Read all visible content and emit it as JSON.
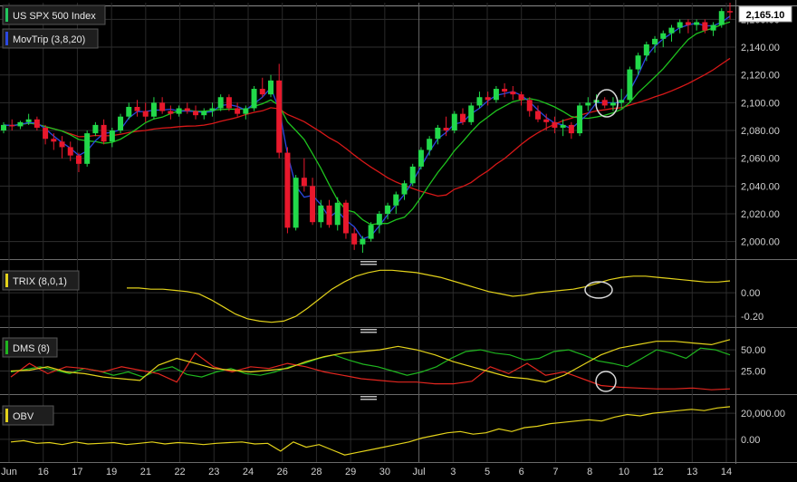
{
  "chart_data": [
    {
      "type": "candlestick",
      "title": "US SPX 500 Index",
      "overlay_label": "MovTrip (3,8,20)",
      "last_price_label": "2,165.10",
      "y_ticks": [
        "2,000.00",
        "2,020.00",
        "2,040.00",
        "2,060.00",
        "2,080.00",
        "2,100.00",
        "2,120.00",
        "2,140.00",
        "2,160.00"
      ],
      "ylim": [
        1990,
        2172
      ],
      "colors": {
        "up": "#22d94a",
        "down": "#e8182c",
        "fast": "#2a47e0",
        "mid": "#1ec21e",
        "slow": "#d81818"
      },
      "candles": [
        [
          2080,
          2086,
          2078,
          2084
        ],
        [
          2084,
          2088,
          2080,
          2083
        ],
        [
          2083,
          2087,
          2081,
          2086
        ],
        [
          2086,
          2092,
          2084,
          2088
        ],
        [
          2088,
          2090,
          2080,
          2082
        ],
        [
          2082,
          2084,
          2070,
          2074
        ],
        [
          2074,
          2078,
          2066,
          2072
        ],
        [
          2072,
          2076,
          2060,
          2068
        ],
        [
          2068,
          2072,
          2058,
          2062
        ],
        [
          2062,
          2064,
          2050,
          2056
        ],
        [
          2056,
          2080,
          2054,
          2078
        ],
        [
          2078,
          2086,
          2076,
          2084
        ],
        [
          2084,
          2088,
          2070,
          2072
        ],
        [
          2072,
          2082,
          2068,
          2080
        ],
        [
          2080,
          2092,
          2078,
          2090
        ],
        [
          2090,
          2100,
          2088,
          2097
        ],
        [
          2097,
          2102,
          2090,
          2094
        ],
        [
          2094,
          2100,
          2086,
          2090
        ],
        [
          2090,
          2104,
          2088,
          2100
        ],
        [
          2100,
          2104,
          2092,
          2094
        ],
        [
          2094,
          2098,
          2088,
          2092
        ],
        [
          2092,
          2098,
          2090,
          2096
        ],
        [
          2096,
          2100,
          2092,
          2094
        ],
        [
          2094,
          2098,
          2088,
          2091
        ],
        [
          2091,
          2096,
          2088,
          2094
        ],
        [
          2094,
          2100,
          2090,
          2096
        ],
        [
          2096,
          2106,
          2094,
          2104
        ],
        [
          2104,
          2106,
          2094,
          2096
        ],
        [
          2096,
          2100,
          2090,
          2092
        ],
        [
          2092,
          2098,
          2088,
          2096
        ],
        [
          2096,
          2112,
          2094,
          2110
        ],
        [
          2110,
          2118,
          2104,
          2106
        ],
        [
          2106,
          2120,
          2104,
          2116
        ],
        [
          2116,
          2128,
          2060,
          2064
        ],
        [
          2064,
          2068,
          2006,
          2010
        ],
        [
          2010,
          2048,
          2008,
          2046
        ],
        [
          2046,
          2060,
          2036,
          2040
        ],
        [
          2040,
          2046,
          2012,
          2014
        ],
        [
          2014,
          2030,
          2010,
          2026
        ],
        [
          2026,
          2030,
          2010,
          2012
        ],
        [
          2012,
          2032,
          2008,
          2028
        ],
        [
          2028,
          2030,
          2002,
          2006
        ],
        [
          2006,
          2010,
          1994,
          1998
        ],
        [
          1998,
          2004,
          1992,
          2002
        ],
        [
          2002,
          2014,
          2000,
          2012
        ],
        [
          2012,
          2022,
          2006,
          2020
        ],
        [
          2020,
          2028,
          2016,
          2026
        ],
        [
          2026,
          2036,
          2020,
          2034
        ],
        [
          2034,
          2044,
          2030,
          2042
        ],
        [
          2042,
          2056,
          2040,
          2054
        ],
        [
          2054,
          2068,
          2052,
          2066
        ],
        [
          2066,
          2076,
          2062,
          2074
        ],
        [
          2074,
          2084,
          2070,
          2082
        ],
        [
          2082,
          2090,
          2076,
          2080
        ],
        [
          2080,
          2094,
          2078,
          2092
        ],
        [
          2092,
          2096,
          2084,
          2086
        ],
        [
          2086,
          2100,
          2084,
          2098
        ],
        [
          2098,
          2108,
          2096,
          2104
        ],
        [
          2104,
          2108,
          2098,
          2102
        ],
        [
          2102,
          2112,
          2100,
          2110
        ],
        [
          2110,
          2114,
          2104,
          2108
        ],
        [
          2108,
          2112,
          2102,
          2106
        ],
        [
          2106,
          2108,
          2098,
          2102
        ],
        [
          2102,
          2104,
          2090,
          2094
        ],
        [
          2094,
          2098,
          2086,
          2088
        ],
        [
          2088,
          2092,
          2080,
          2086
        ],
        [
          2086,
          2090,
          2078,
          2082
        ],
        [
          2082,
          2088,
          2076,
          2084
        ],
        [
          2084,
          2086,
          2074,
          2078
        ],
        [
          2078,
          2100,
          2076,
          2098
        ],
        [
          2098,
          2104,
          2094,
          2100
        ],
        [
          2100,
          2106,
          2096,
          2102
        ],
        [
          2102,
          2104,
          2096,
          2098
        ],
        [
          2098,
          2104,
          2094,
          2100
        ],
        [
          2100,
          2110,
          2096,
          2102
        ],
        [
          2102,
          2126,
          2100,
          2124
        ],
        [
          2124,
          2136,
          2120,
          2134
        ],
        [
          2134,
          2144,
          2130,
          2142
        ],
        [
          2142,
          2148,
          2136,
          2146
        ],
        [
          2146,
          2152,
          2140,
          2150
        ],
        [
          2150,
          2156,
          2144,
          2154
        ],
        [
          2154,
          2160,
          2150,
          2158
        ],
        [
          2158,
          2160,
          2150,
          2156
        ],
        [
          2156,
          2160,
          2152,
          2158
        ],
        [
          2158,
          2160,
          2150,
          2152
        ],
        [
          2152,
          2158,
          2148,
          2156
        ],
        [
          2156,
          2168,
          2154,
          2166
        ],
        [
          2166,
          2172,
          2160,
          2165
        ]
      ]
    },
    {
      "type": "line",
      "label": "TRIX (8,0,1)",
      "y_ticks": [
        "0.00",
        "-0.20"
      ],
      "series": [
        {
          "color": "#e3d21a",
          "values": [
            0.04,
            0.04,
            0.03,
            0.03,
            0.02,
            0.01,
            -0.01,
            -0.06,
            -0.12,
            -0.18,
            -0.22,
            -0.24,
            -0.25,
            -0.24,
            -0.2,
            -0.13,
            -0.05,
            0.03,
            0.09,
            0.14,
            0.17,
            0.19,
            0.19,
            0.18,
            0.17,
            0.15,
            0.13,
            0.1,
            0.07,
            0.04,
            0.01,
            -0.01,
            -0.03,
            -0.02,
            0.0,
            0.01,
            0.02,
            0.03,
            0.05,
            0.08,
            0.11,
            0.13,
            0.14,
            0.14,
            0.13,
            0.12,
            0.11,
            0.1,
            0.09,
            0.09,
            0.1
          ]
        }
      ]
    },
    {
      "type": "line",
      "label": "DMS (8)",
      "y_ticks": [
        "50.00",
        "25.00"
      ],
      "series": [
        {
          "color": "#1fb51f",
          "values": [
            24,
            27,
            30,
            26,
            22,
            28,
            25,
            20,
            24,
            18,
            26,
            30,
            21,
            18,
            24,
            28,
            22,
            20,
            24,
            30,
            34,
            40,
            44,
            38,
            33,
            30,
            25,
            20,
            24,
            30,
            40,
            48,
            50,
            46,
            44,
            38,
            40,
            48,
            50,
            44,
            37,
            34,
            30,
            40,
            50,
            46,
            40,
            52,
            50,
            44
          ]
        },
        {
          "color": "#e1261f",
          "values": [
            18,
            34,
            22,
            30,
            28,
            24,
            30,
            26,
            22,
            12,
            46,
            30,
            24,
            30,
            28,
            34,
            30,
            24,
            20,
            16,
            14,
            12,
            12,
            10,
            10,
            13,
            30,
            22,
            34,
            20,
            24,
            16,
            8,
            6,
            5,
            4,
            4,
            5,
            3,
            4
          ]
        },
        {
          "color": "#e3d21a",
          "values": [
            25,
            26,
            30,
            24,
            22,
            18,
            16,
            14,
            32,
            40,
            34,
            28,
            26,
            24,
            26,
            28,
            36,
            42,
            46,
            48,
            50,
            54,
            50,
            44,
            36,
            30,
            24,
            18,
            16,
            12,
            20,
            32,
            44,
            52,
            56,
            60,
            60,
            58,
            56,
            62
          ]
        }
      ]
    },
    {
      "type": "line",
      "label": "OBV",
      "y_ticks": [
        "20,000.00",
        "0.00"
      ],
      "series": [
        {
          "color": "#e3d21a",
          "values": [
            -2000,
            -1000,
            -3000,
            -2500,
            -4000,
            -2000,
            -3500,
            -3000,
            -2500,
            -4000,
            -3000,
            -2000,
            -3500,
            -2500,
            -3000,
            -4000,
            -3000,
            -2500,
            -2000,
            -3500,
            -3000,
            -9000,
            -2000,
            -6000,
            -4000,
            -8000,
            -12000,
            -10000,
            -8000,
            -6000,
            -4000,
            -2000,
            1000,
            3000,
            5000,
            6000,
            4000,
            5000,
            8000,
            6000,
            9000,
            10000,
            12000,
            13000,
            14000,
            15000,
            14000,
            17000,
            19000,
            18000,
            20000,
            21000,
            22000,
            23000,
            22000,
            24000,
            25000
          ]
        }
      ]
    }
  ],
  "x_axis_labels": [
    "Jun",
    "16",
    "17",
    "19",
    "21",
    "22",
    "23",
    "24",
    "26",
    "28",
    "29",
    "30",
    "Jul",
    "3",
    "5",
    "6",
    "7",
    "8",
    "10",
    "12",
    "13",
    "14"
  ]
}
